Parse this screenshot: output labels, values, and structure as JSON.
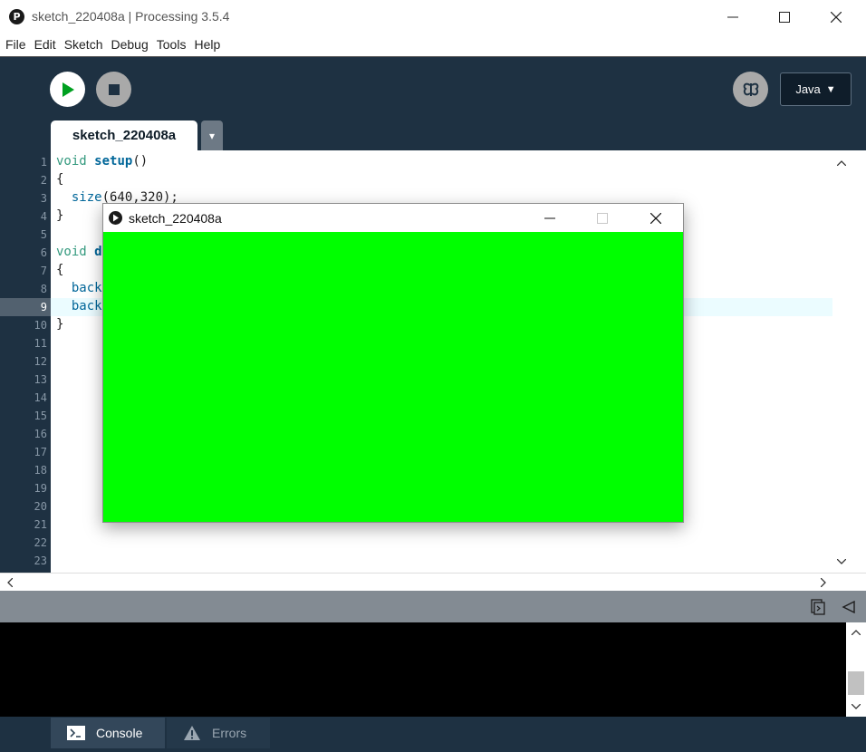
{
  "window": {
    "title": "sketch_220408a | Processing 3.5.4",
    "app_icon_glyph": "P"
  },
  "menu": [
    "File",
    "Edit",
    "Sketch",
    "Debug",
    "Tools",
    "Help"
  ],
  "toolbar": {
    "mode": "Java",
    "mode_arrow": "▼"
  },
  "tab": {
    "name": "sketch_220408a",
    "menu_glyph": "▾"
  },
  "editor": {
    "line_numbers": [
      "1",
      "2",
      "3",
      "4",
      "5",
      "6",
      "7",
      "8",
      "9",
      "10",
      "11",
      "12",
      "13",
      "14",
      "15",
      "16",
      "17",
      "18",
      "19",
      "20",
      "21",
      "22",
      "23"
    ],
    "active_line": 9,
    "code": {
      "l1_kw": "void",
      "l1_fn": "setup",
      "l1_rest": "()",
      "l2": "{",
      "l3_fn": "size",
      "l3_rest": "(640,320);",
      "l4": "}",
      "l6_kw": "void",
      "l6_fn": "d",
      "l7": "{",
      "l8": "back",
      "l9": "back",
      "l10": "}"
    }
  },
  "bottom_tabs": {
    "console": "Console",
    "errors": "Errors"
  },
  "sketch_window": {
    "title": "sketch_220408a",
    "canvas_color": "#00ff00"
  },
  "colors": {
    "ide_background": "#1e3142",
    "run_icon": "#00a020",
    "highlight_line": "#ebfcff"
  }
}
